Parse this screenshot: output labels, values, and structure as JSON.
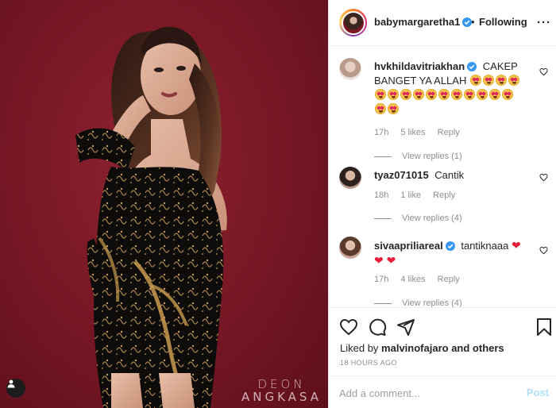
{
  "photo": {
    "description_icon": "user-tag-icon",
    "watermark_line1": "DEON",
    "watermark_line2": "ANGKASA"
  },
  "header": {
    "username": "babymargaretha1",
    "separator": "•",
    "follow_status": "Following",
    "more_icon": "more-icon",
    "verified_icon": "verified-badge-icon"
  },
  "comments": [
    {
      "username": "hvkhildavitriakhan",
      "verified": true,
      "text": "CAKEP BANGET YA ALLAH",
      "emoji_count": 17,
      "time": "17h",
      "likes": "5 likes",
      "reply": "Reply",
      "view_replies": "View replies (1)"
    },
    {
      "username": "tyaz071015",
      "verified": false,
      "text": "Cantik",
      "time": "18h",
      "likes": "1 like",
      "reply": "Reply",
      "view_replies": "View replies (4)"
    },
    {
      "username": "sivaapriliareal",
      "verified": true,
      "text": "tantiknaaa",
      "hearts": "❤ ❤ ❤",
      "time": "17h",
      "likes": "4 likes",
      "reply": "Reply",
      "view_replies": "View replies (4)"
    }
  ],
  "actions": {
    "icons": [
      "heart-icon",
      "comment-icon",
      "share-icon",
      "bookmark-icon"
    ],
    "liked_by_prefix": "Liked by",
    "liked_by_user": "malvinofajaro",
    "liked_by_suffix": "and others",
    "timestamp": "18 HOURS AGO"
  },
  "add_comment": {
    "placeholder": "Add a comment...",
    "post_label": "Post"
  },
  "colors": {
    "background_red": "#7a1826",
    "link_blue": "#b2dffc",
    "verified_blue": "#3897f0",
    "text": "#262626",
    "muted": "#8e8e8e"
  }
}
